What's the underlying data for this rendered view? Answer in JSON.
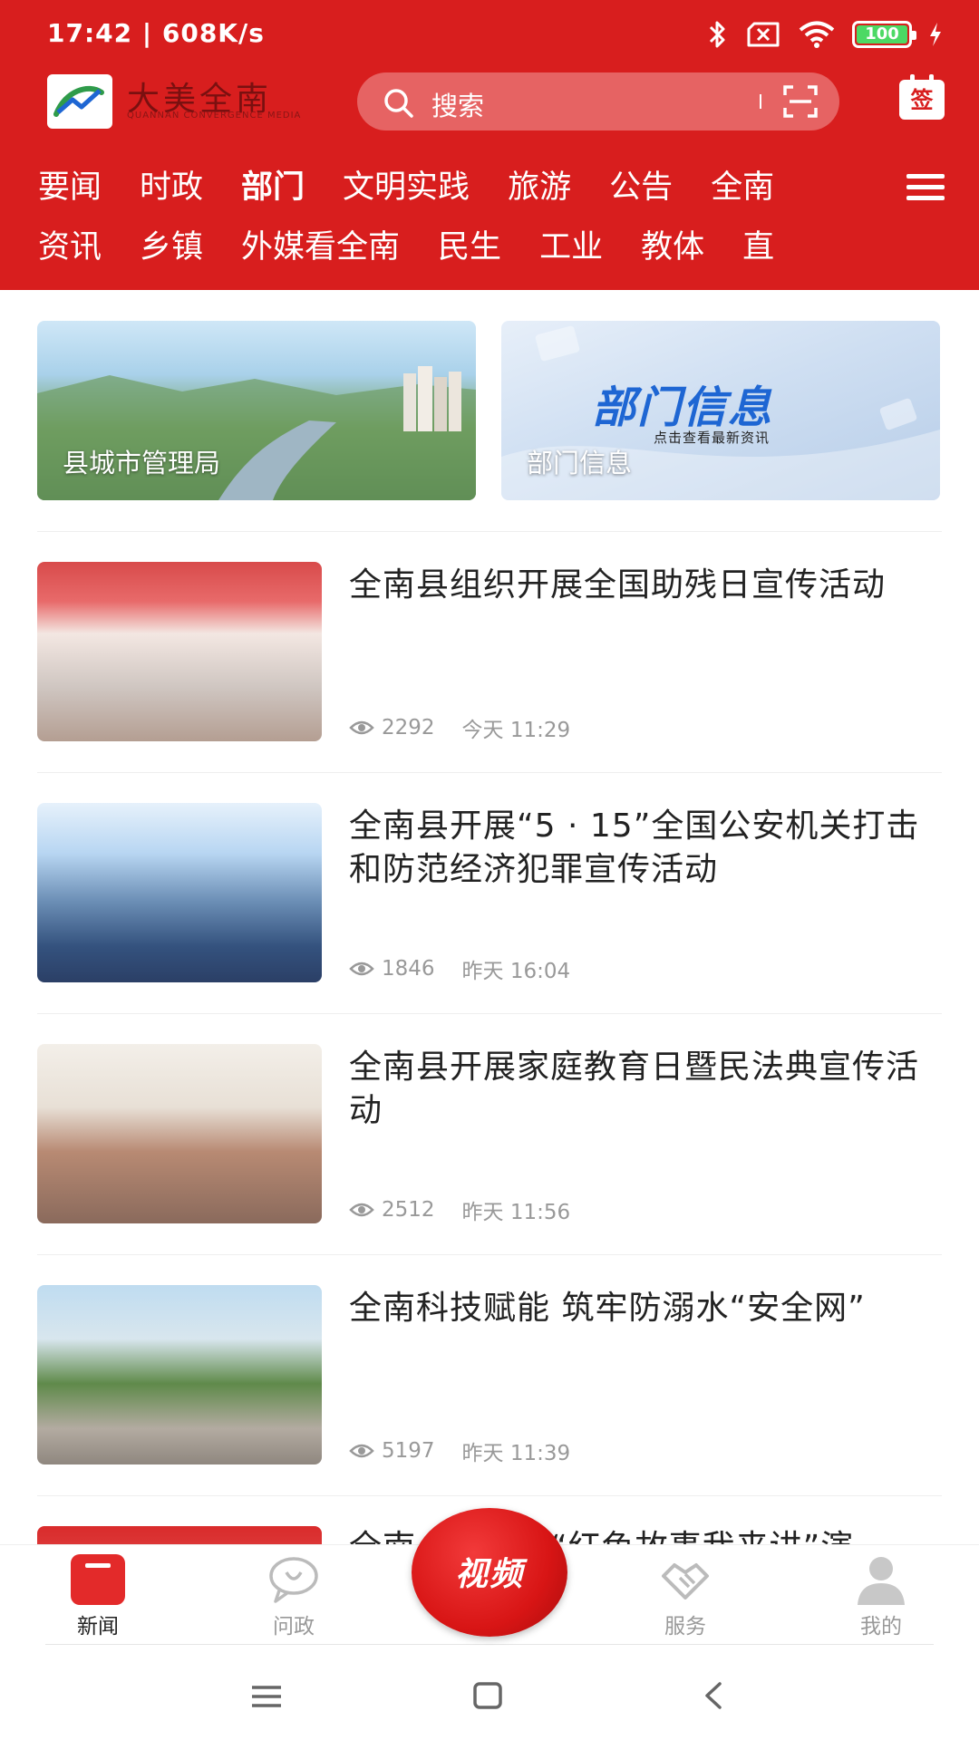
{
  "status_bar": {
    "time": "17:42 | 608K/s",
    "battery_level": "100"
  },
  "header": {
    "logo_text": "大美全南",
    "logo_subtext": "QUANNAN CONVERGENCE MEDIA",
    "search_placeholder": "搜索",
    "sign_label": "签"
  },
  "nav": {
    "row1": [
      "要闻",
      "时政",
      "部门",
      "文明实践",
      "旅游",
      "公告",
      "全南"
    ],
    "row2": [
      "资讯",
      "乡镇",
      "外媒看全南",
      "民生",
      "工业",
      "教体",
      "直"
    ],
    "active": "部门"
  },
  "banners": [
    {
      "label": "县城市管理局"
    },
    {
      "label": "部门信息",
      "title": "部门信息",
      "subtitle": "点击查看最新资讯"
    }
  ],
  "news": [
    {
      "title": "全南县组织开展全国助残日宣传活动",
      "views": "2292",
      "time": "今天 11:29"
    },
    {
      "title": "全南县开展“5 · 15”全国公安机关打击和防范经济犯罪宣传活动",
      "views": "1846",
      "time": "昨天 16:04"
    },
    {
      "title": "全南县开展家庭教育日暨民法典宣传活动",
      "views": "2512",
      "time": "昨天 11:56"
    },
    {
      "title": "全南科技赋能 筑牢防溺水“安全网”",
      "views": "5197",
      "time": "昨天 11:39"
    },
    {
      "title": "全南…………“红色故事我来讲”演",
      "views": "",
      "time": ""
    }
  ],
  "tab_bar": {
    "tabs": [
      {
        "label": "新闻",
        "icon": "news-icon"
      },
      {
        "label": "问政",
        "icon": "chat-bubble-icon"
      },
      {
        "label": "服务",
        "icon": "handshake-icon"
      },
      {
        "label": "我的",
        "icon": "user-icon"
      }
    ],
    "video_label": "视频",
    "active": "新闻"
  },
  "colors": {
    "brand_red": "#d81e1e",
    "search_bg": "#e66363",
    "text_primary": "#222222",
    "text_meta": "#999999"
  }
}
